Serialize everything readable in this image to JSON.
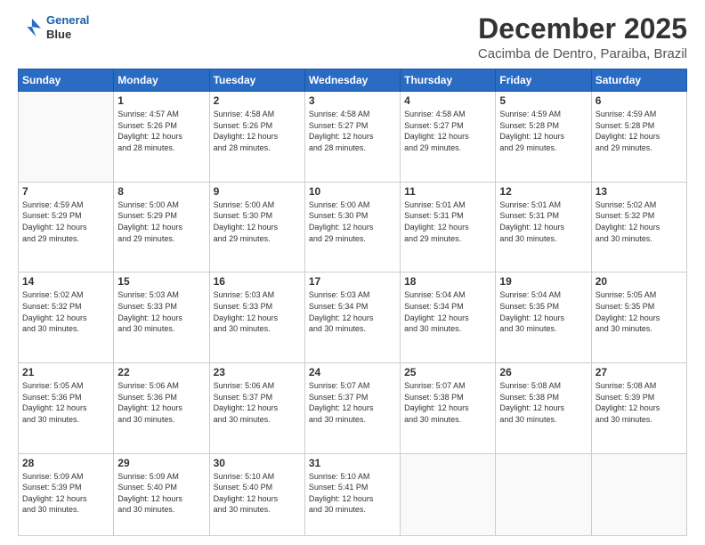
{
  "header": {
    "logo_line1": "General",
    "logo_line2": "Blue",
    "main_title": "December 2025",
    "subtitle": "Cacimba de Dentro, Paraiba, Brazil"
  },
  "calendar": {
    "days_of_week": [
      "Sunday",
      "Monday",
      "Tuesday",
      "Wednesday",
      "Thursday",
      "Friday",
      "Saturday"
    ],
    "weeks": [
      [
        {
          "day": "",
          "info": ""
        },
        {
          "day": "1",
          "info": "Sunrise: 4:57 AM\nSunset: 5:26 PM\nDaylight: 12 hours\nand 28 minutes."
        },
        {
          "day": "2",
          "info": "Sunrise: 4:58 AM\nSunset: 5:26 PM\nDaylight: 12 hours\nand 28 minutes."
        },
        {
          "day": "3",
          "info": "Sunrise: 4:58 AM\nSunset: 5:27 PM\nDaylight: 12 hours\nand 28 minutes."
        },
        {
          "day": "4",
          "info": "Sunrise: 4:58 AM\nSunset: 5:27 PM\nDaylight: 12 hours\nand 29 minutes."
        },
        {
          "day": "5",
          "info": "Sunrise: 4:59 AM\nSunset: 5:28 PM\nDaylight: 12 hours\nand 29 minutes."
        },
        {
          "day": "6",
          "info": "Sunrise: 4:59 AM\nSunset: 5:28 PM\nDaylight: 12 hours\nand 29 minutes."
        }
      ],
      [
        {
          "day": "7",
          "info": "Sunrise: 4:59 AM\nSunset: 5:29 PM\nDaylight: 12 hours\nand 29 minutes."
        },
        {
          "day": "8",
          "info": "Sunrise: 5:00 AM\nSunset: 5:29 PM\nDaylight: 12 hours\nand 29 minutes."
        },
        {
          "day": "9",
          "info": "Sunrise: 5:00 AM\nSunset: 5:30 PM\nDaylight: 12 hours\nand 29 minutes."
        },
        {
          "day": "10",
          "info": "Sunrise: 5:00 AM\nSunset: 5:30 PM\nDaylight: 12 hours\nand 29 minutes."
        },
        {
          "day": "11",
          "info": "Sunrise: 5:01 AM\nSunset: 5:31 PM\nDaylight: 12 hours\nand 29 minutes."
        },
        {
          "day": "12",
          "info": "Sunrise: 5:01 AM\nSunset: 5:31 PM\nDaylight: 12 hours\nand 30 minutes."
        },
        {
          "day": "13",
          "info": "Sunrise: 5:02 AM\nSunset: 5:32 PM\nDaylight: 12 hours\nand 30 minutes."
        }
      ],
      [
        {
          "day": "14",
          "info": "Sunrise: 5:02 AM\nSunset: 5:32 PM\nDaylight: 12 hours\nand 30 minutes."
        },
        {
          "day": "15",
          "info": "Sunrise: 5:03 AM\nSunset: 5:33 PM\nDaylight: 12 hours\nand 30 minutes."
        },
        {
          "day": "16",
          "info": "Sunrise: 5:03 AM\nSunset: 5:33 PM\nDaylight: 12 hours\nand 30 minutes."
        },
        {
          "day": "17",
          "info": "Sunrise: 5:03 AM\nSunset: 5:34 PM\nDaylight: 12 hours\nand 30 minutes."
        },
        {
          "day": "18",
          "info": "Sunrise: 5:04 AM\nSunset: 5:34 PM\nDaylight: 12 hours\nand 30 minutes."
        },
        {
          "day": "19",
          "info": "Sunrise: 5:04 AM\nSunset: 5:35 PM\nDaylight: 12 hours\nand 30 minutes."
        },
        {
          "day": "20",
          "info": "Sunrise: 5:05 AM\nSunset: 5:35 PM\nDaylight: 12 hours\nand 30 minutes."
        }
      ],
      [
        {
          "day": "21",
          "info": "Sunrise: 5:05 AM\nSunset: 5:36 PM\nDaylight: 12 hours\nand 30 minutes."
        },
        {
          "day": "22",
          "info": "Sunrise: 5:06 AM\nSunset: 5:36 PM\nDaylight: 12 hours\nand 30 minutes."
        },
        {
          "day": "23",
          "info": "Sunrise: 5:06 AM\nSunset: 5:37 PM\nDaylight: 12 hours\nand 30 minutes."
        },
        {
          "day": "24",
          "info": "Sunrise: 5:07 AM\nSunset: 5:37 PM\nDaylight: 12 hours\nand 30 minutes."
        },
        {
          "day": "25",
          "info": "Sunrise: 5:07 AM\nSunset: 5:38 PM\nDaylight: 12 hours\nand 30 minutes."
        },
        {
          "day": "26",
          "info": "Sunrise: 5:08 AM\nSunset: 5:38 PM\nDaylight: 12 hours\nand 30 minutes."
        },
        {
          "day": "27",
          "info": "Sunrise: 5:08 AM\nSunset: 5:39 PM\nDaylight: 12 hours\nand 30 minutes."
        }
      ],
      [
        {
          "day": "28",
          "info": "Sunrise: 5:09 AM\nSunset: 5:39 PM\nDaylight: 12 hours\nand 30 minutes."
        },
        {
          "day": "29",
          "info": "Sunrise: 5:09 AM\nSunset: 5:40 PM\nDaylight: 12 hours\nand 30 minutes."
        },
        {
          "day": "30",
          "info": "Sunrise: 5:10 AM\nSunset: 5:40 PM\nDaylight: 12 hours\nand 30 minutes."
        },
        {
          "day": "31",
          "info": "Sunrise: 5:10 AM\nSunset: 5:41 PM\nDaylight: 12 hours\nand 30 minutes."
        },
        {
          "day": "",
          "info": ""
        },
        {
          "day": "",
          "info": ""
        },
        {
          "day": "",
          "info": ""
        }
      ]
    ]
  }
}
